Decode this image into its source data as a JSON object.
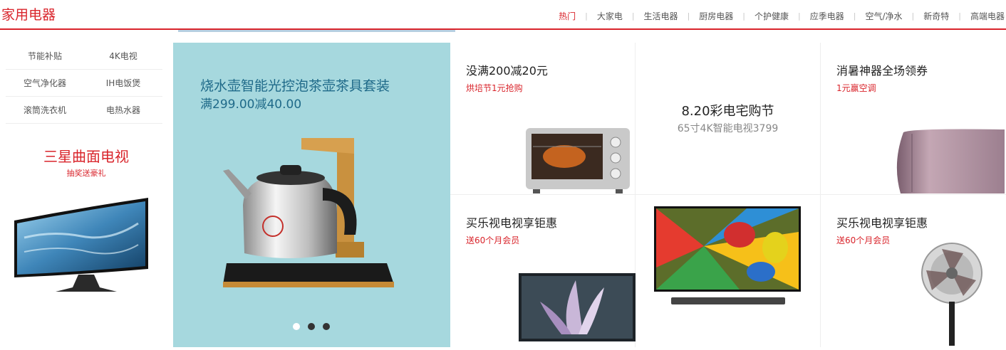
{
  "header": {
    "title": "家用电器",
    "tabs": [
      "热门",
      "大家电",
      "生活电器",
      "厨房电器",
      "个护健康",
      "应季电器",
      "空气/净水",
      "新奇特",
      "高端电器"
    ]
  },
  "left": {
    "links": [
      [
        "节能补贴",
        "4K电视"
      ],
      [
        "空气净化器",
        "IH电饭煲"
      ],
      [
        "滚筒洗衣机",
        "电热水器"
      ]
    ],
    "promo_title": "三星曲面电视",
    "promo_sub": "抽奖送豪礼"
  },
  "banner": {
    "title": "烧水壶智能光控泡茶壶茶具套装",
    "subtitle": "满299.00减40.00"
  },
  "grid": [
    {
      "title": "没满200减20元",
      "subtitle": "烘培节1元抢购"
    },
    {
      "title": "8.20彩电宅购节",
      "subtitle": "65寸4K智能电视3799"
    },
    {
      "title": "消暑神器全场领券",
      "subtitle": "1元赢空调"
    },
    {
      "title": "买乐视电视享钜惠",
      "subtitle": "送60个月会员"
    },
    {
      "title": "",
      "subtitle": ""
    },
    {
      "title": "买乐视电视享钜惠",
      "subtitle": "送60个月会员"
    }
  ],
  "colors": {
    "brand": "#d9242b",
    "banner_bg": "#a6d8de",
    "banner_text": "#1f6a89"
  },
  "icons": [
    "curved-tv-image",
    "kettle-image",
    "oven-image",
    "air-conditioner-image",
    "tv-image",
    "fan-image"
  ]
}
